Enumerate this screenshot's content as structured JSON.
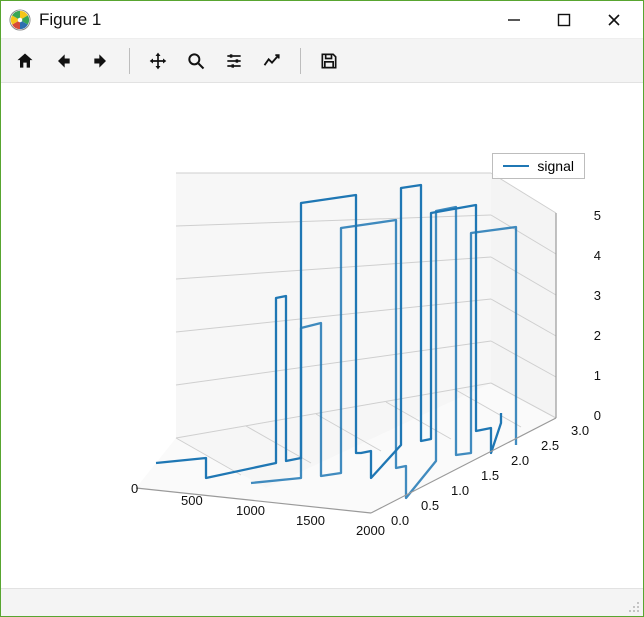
{
  "window": {
    "title": "Figure 1"
  },
  "toolbar": {
    "home": "Home",
    "back": "Back",
    "forward": "Forward",
    "pan": "Pan",
    "zoom": "Zoom",
    "subplots": "Configure subplots",
    "edit": "Edit parameters",
    "save": "Save"
  },
  "legend": {
    "series_0": "signal"
  },
  "chart_data": {
    "type": "line",
    "dimensions": 3,
    "series": [
      {
        "name": "signal",
        "color": "#1f77b4"
      }
    ],
    "x_ticks": [
      0,
      500,
      1000,
      1500,
      2000
    ],
    "y_ticks": [
      0.0,
      0.5,
      1.0,
      1.5,
      2.0,
      2.5,
      3.0
    ],
    "z_ticks": [
      0,
      1,
      2,
      3,
      4,
      5
    ],
    "xlim": [
      0,
      2200
    ],
    "ylim": [
      0.0,
      3.0
    ],
    "zlim": [
      0,
      5
    ],
    "note": "3D line plot with rectangular step-like excursions; numeric xyz samples not individually labeled in the image."
  },
  "ticks": {
    "x0": "0",
    "x1": "500",
    "x2": "1000",
    "x3": "1500",
    "x4": "2000",
    "y0": "0.0",
    "y1": "0.5",
    "y2": "1.0",
    "y3": "1.5",
    "y4": "2.0",
    "y5": "2.5",
    "y6": "3.0",
    "z0": "0",
    "z1": "1",
    "z2": "2",
    "z3": "3",
    "z4": "4",
    "z5": "5"
  }
}
